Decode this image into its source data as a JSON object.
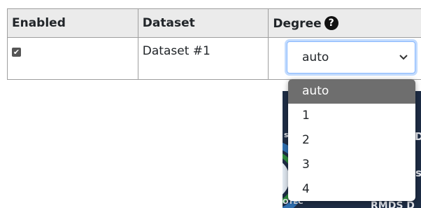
{
  "table": {
    "headers": {
      "enabled": "Enabled",
      "dataset": "Dataset",
      "degree": "Degree",
      "help_glyph": "?"
    },
    "rows": [
      {
        "enabled": true,
        "check_glyph": "✔",
        "dataset": "Dataset #1",
        "degree": "auto"
      }
    ]
  },
  "degree_select": {
    "value": "auto",
    "chevron": "⌄",
    "options": [
      "auto",
      "1",
      "2",
      "3",
      "4"
    ],
    "highlighted": "auto"
  },
  "background_text": {
    "right_top": "D",
    "right_mid": "s",
    "left_s": "s",
    "bottom_left": "OTEC",
    "bottom_right": "RMDS D"
  },
  "colors": {
    "header_bg": "#ebebeb",
    "border": "#9e9e9e",
    "focus_ring": "#86b7fe",
    "menu_selected_bg": "#6e6e6e",
    "background_image": "#1e2d45"
  }
}
